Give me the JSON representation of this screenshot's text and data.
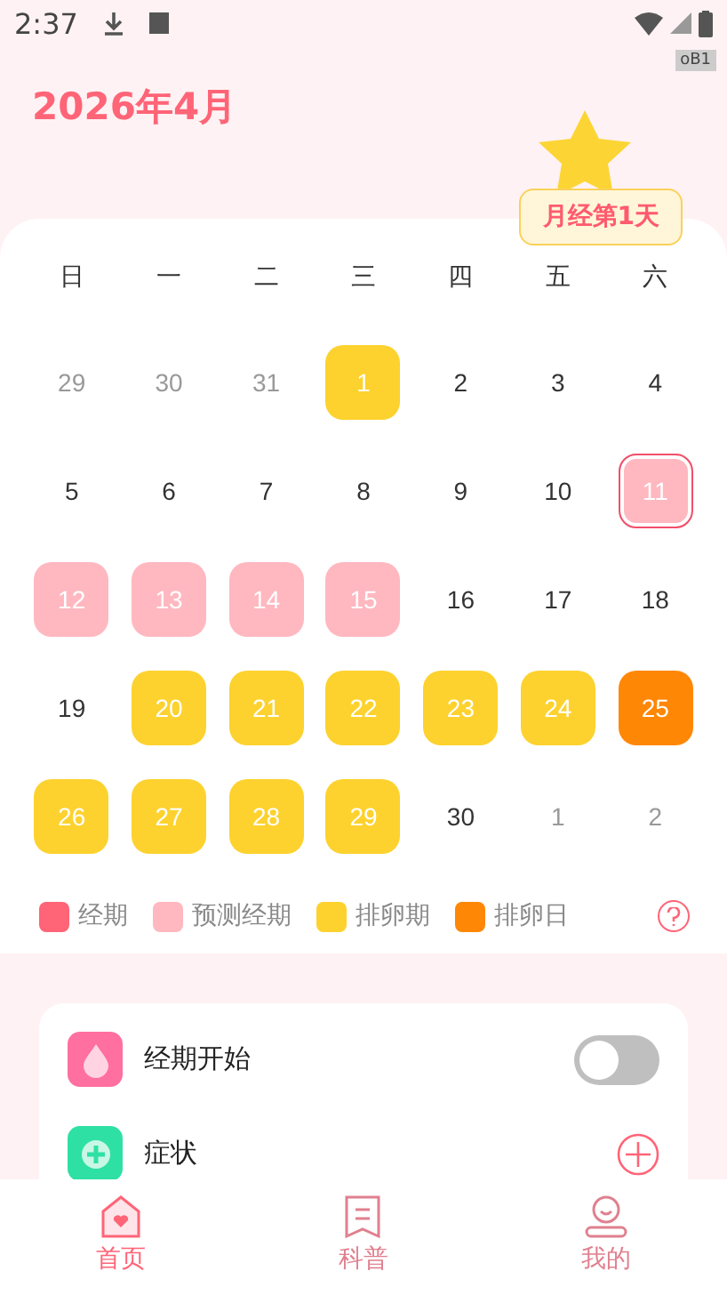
{
  "status_bar": {
    "time": "2:37",
    "badge": "oB1"
  },
  "header": {
    "month": "2026年4月",
    "bubble": "月经第1天"
  },
  "calendar": {
    "weekdays": [
      "日",
      "一",
      "二",
      "三",
      "四",
      "五",
      "六"
    ],
    "days": [
      {
        "label": "29",
        "kind": "other",
        "selected": false
      },
      {
        "label": "30",
        "kind": "other",
        "selected": false
      },
      {
        "label": "31",
        "kind": "other",
        "selected": false
      },
      {
        "label": "1",
        "kind": "fertile",
        "selected": false
      },
      {
        "label": "2",
        "kind": "plain",
        "selected": false
      },
      {
        "label": "3",
        "kind": "plain",
        "selected": false
      },
      {
        "label": "4",
        "kind": "plain",
        "selected": false
      },
      {
        "label": "5",
        "kind": "plain",
        "selected": false
      },
      {
        "label": "6",
        "kind": "plain",
        "selected": false
      },
      {
        "label": "7",
        "kind": "plain",
        "selected": false
      },
      {
        "label": "8",
        "kind": "plain",
        "selected": false
      },
      {
        "label": "9",
        "kind": "plain",
        "selected": false
      },
      {
        "label": "10",
        "kind": "plain",
        "selected": false
      },
      {
        "label": "11",
        "kind": "predicted",
        "selected": true
      },
      {
        "label": "12",
        "kind": "predicted",
        "selected": false
      },
      {
        "label": "13",
        "kind": "predicted",
        "selected": false
      },
      {
        "label": "14",
        "kind": "predicted",
        "selected": false
      },
      {
        "label": "15",
        "kind": "predicted",
        "selected": false
      },
      {
        "label": "16",
        "kind": "plain",
        "selected": false
      },
      {
        "label": "17",
        "kind": "plain",
        "selected": false
      },
      {
        "label": "18",
        "kind": "plain",
        "selected": false
      },
      {
        "label": "19",
        "kind": "plain",
        "selected": false
      },
      {
        "label": "20",
        "kind": "fertile",
        "selected": false
      },
      {
        "label": "21",
        "kind": "fertile",
        "selected": false
      },
      {
        "label": "22",
        "kind": "fertile",
        "selected": false
      },
      {
        "label": "23",
        "kind": "fertile",
        "selected": false
      },
      {
        "label": "24",
        "kind": "fertile",
        "selected": false
      },
      {
        "label": "25",
        "kind": "ovulation",
        "selected": false
      },
      {
        "label": "26",
        "kind": "fertile",
        "selected": false
      },
      {
        "label": "27",
        "kind": "fertile",
        "selected": false
      },
      {
        "label": "28",
        "kind": "fertile",
        "selected": false
      },
      {
        "label": "29",
        "kind": "fertile",
        "selected": false
      },
      {
        "label": "30",
        "kind": "plain",
        "selected": false
      },
      {
        "label": "1",
        "kind": "other",
        "selected": false
      },
      {
        "label": "2",
        "kind": "other",
        "selected": false
      }
    ]
  },
  "legend": [
    {
      "label": "经期",
      "color": "#ff6477"
    },
    {
      "label": "预测经期",
      "color": "#ffb8c0"
    },
    {
      "label": "排卵期",
      "color": "#fdd22e"
    },
    {
      "label": "排卵日",
      "color": "#ff8706"
    }
  ],
  "records": [
    {
      "label": "经期开始",
      "kind": "toggle",
      "on": false
    },
    {
      "label": "症状",
      "kind": "add"
    }
  ],
  "nav": [
    {
      "label": "首页",
      "selected": true
    },
    {
      "label": "科普",
      "selected": false
    },
    {
      "label": "我的",
      "selected": false
    }
  ]
}
